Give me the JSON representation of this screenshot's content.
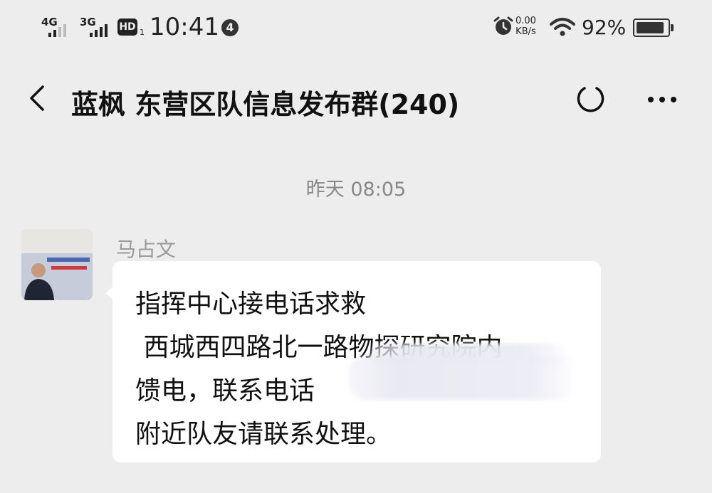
{
  "status_bar": {
    "signal1_label": "4G",
    "signal2_label": "3G",
    "hd_label": "HD",
    "hd_sub": "1",
    "time": "10:41",
    "notification_count": "4",
    "speed_value": "0.00",
    "speed_unit": "KB/s",
    "battery_text": "92%",
    "battery_level": 0.92,
    "icons": [
      "alarm-icon",
      "wifi-icon",
      "battery-icon"
    ]
  },
  "header": {
    "title": "蓝枫 东营区队信息发布群(240)",
    "back_icon": "chevron-left-icon",
    "right_icons": [
      "refresh-ring-icon",
      "more-dots-icon"
    ]
  },
  "chat": {
    "timestamp": "昨天 08:05",
    "message": {
      "sender": "马占文",
      "lines": [
        "指挥中心接电话求救",
        " 西城西四路北一路物探研究院内",
        "馈电，联系电话",
        "附近队友请联系处理。"
      ]
    }
  },
  "colors": {
    "background": "#ededed",
    "bubble": "#ffffff",
    "text": "#111111",
    "muted": "#888888"
  }
}
